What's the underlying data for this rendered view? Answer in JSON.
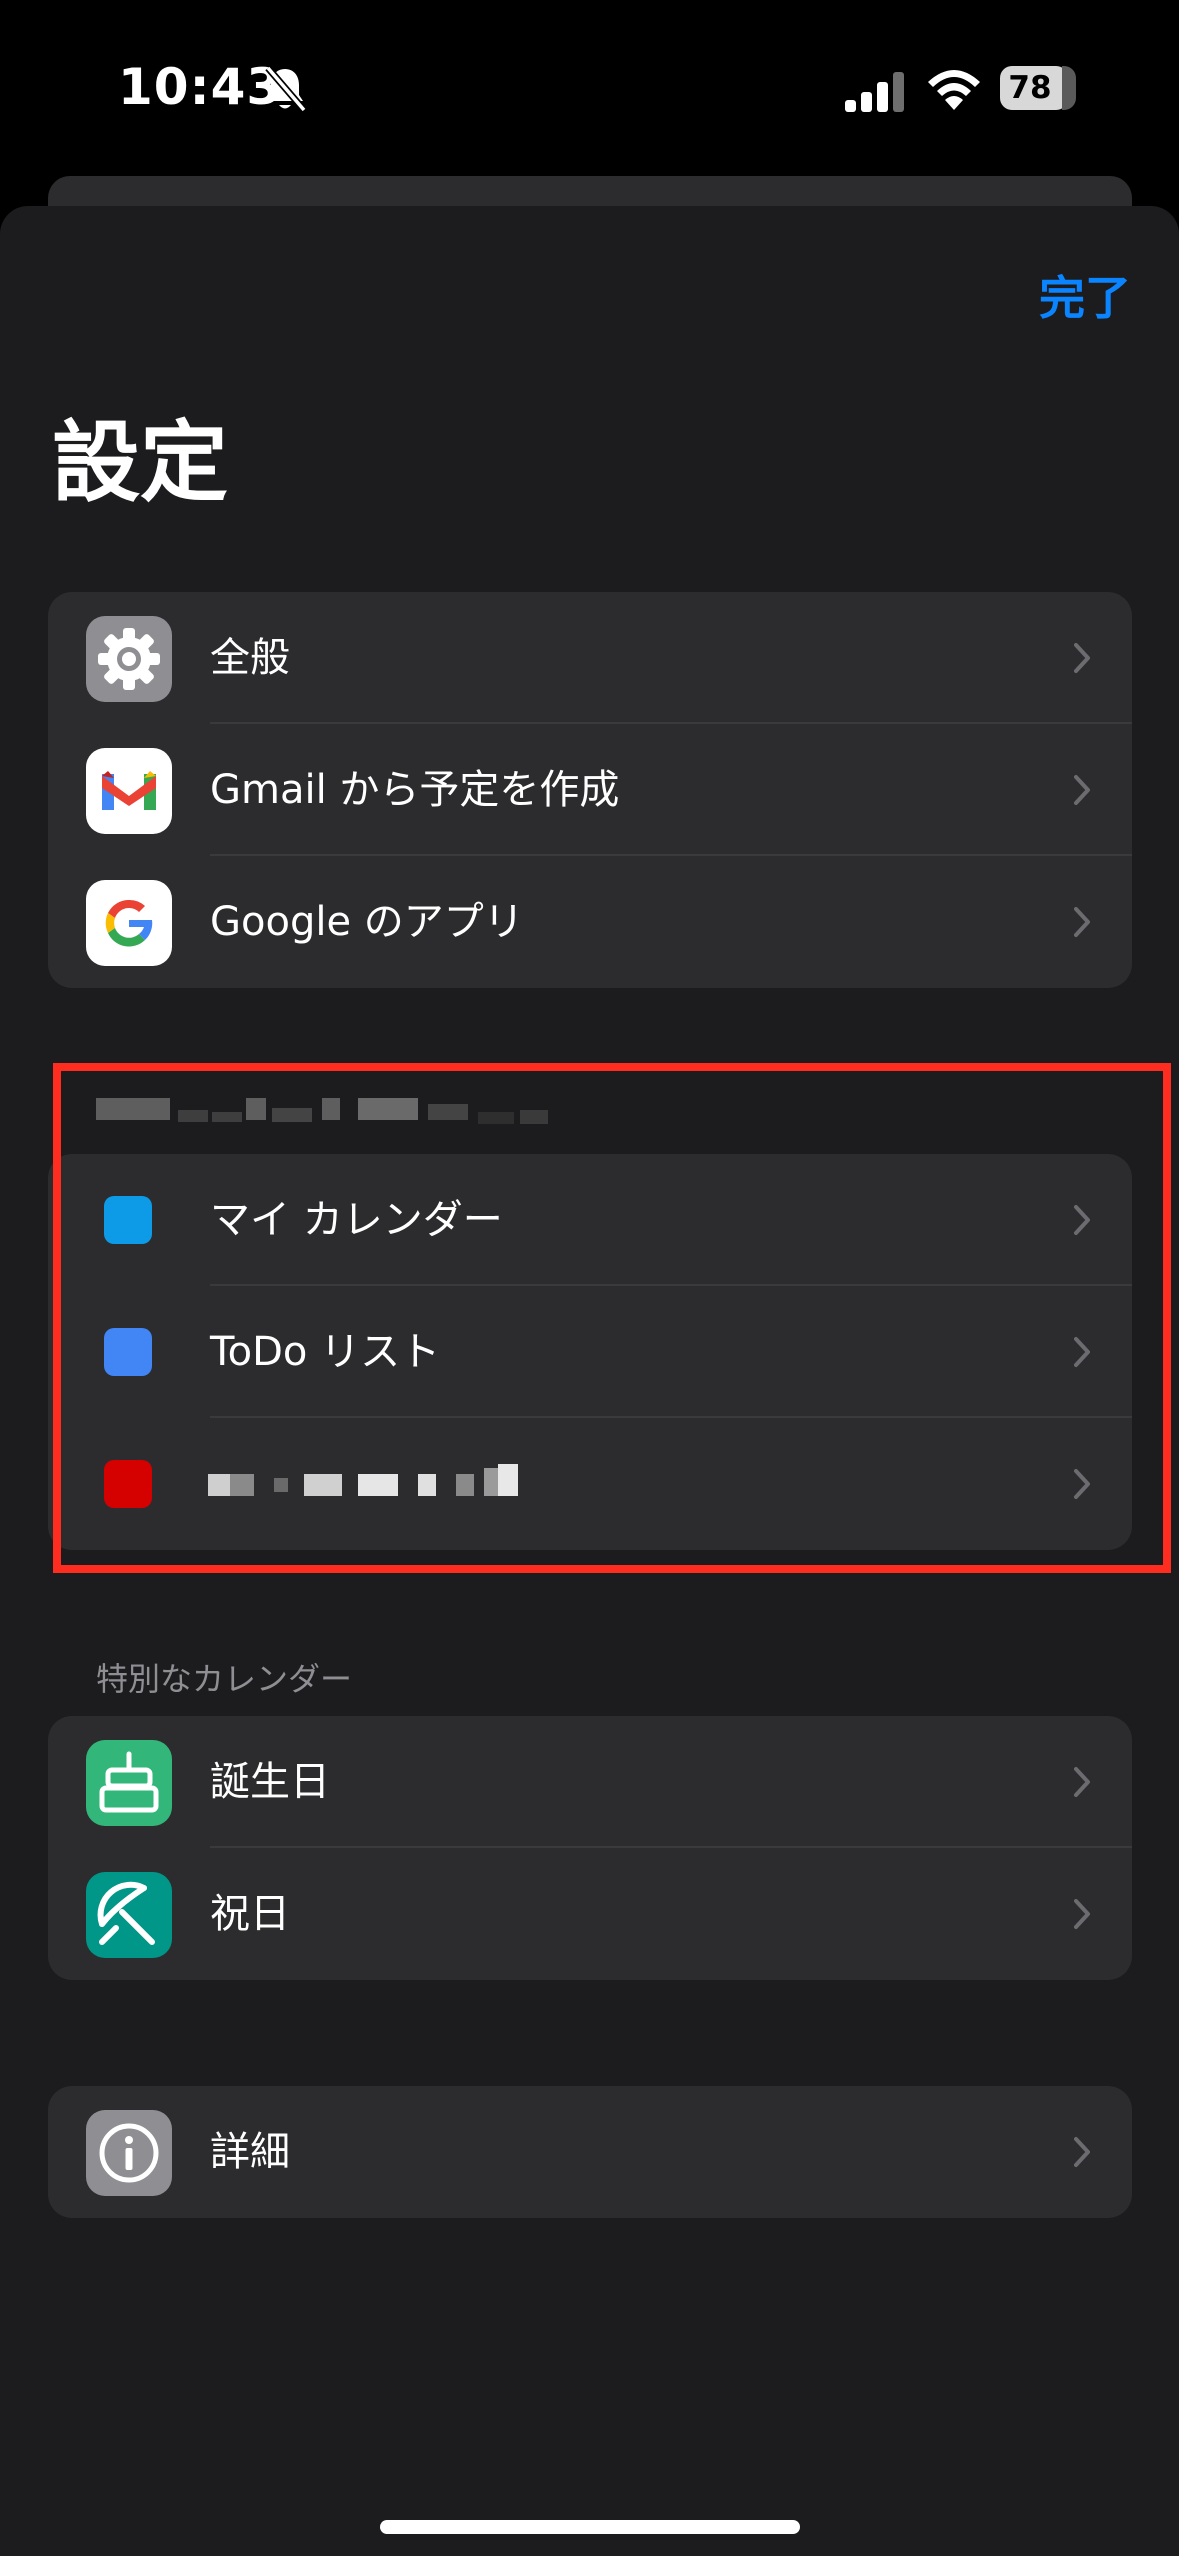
{
  "status_bar": {
    "time": "10:43",
    "battery": "78",
    "icons": [
      "bell-slash-icon",
      "cellular-signal-icon",
      "wifi-icon",
      "battery-icon"
    ]
  },
  "header": {
    "done_label": "完了",
    "title": "設定"
  },
  "groups": {
    "general": [
      {
        "label": "全般",
        "icon": "gear-icon"
      },
      {
        "label": "Gmail から予定を作成",
        "icon": "gmail-icon"
      },
      {
        "label": "Google のアプリ",
        "icon": "google-icon"
      }
    ],
    "account_calendars": [
      {
        "label": "マイ カレンダー",
        "color": "#0d9be7"
      },
      {
        "label": "ToDo リスト",
        "color": "#4285f4"
      },
      {
        "label": "",
        "color": "#d50000"
      }
    ],
    "special_header": "特別なカレンダー",
    "special": [
      {
        "label": "誕生日",
        "icon": "birthday-cake-icon",
        "color": "#33b679"
      },
      {
        "label": "祝日",
        "icon": "holiday-umbrella-icon",
        "color": "#009688"
      }
    ],
    "about": [
      {
        "label": "詳細",
        "icon": "info-icon"
      }
    ]
  },
  "colors": {
    "accent": "#0a84ff",
    "highlight": "#ff2d1f",
    "background": "#1c1c1e",
    "cell": "#2c2c2e"
  }
}
